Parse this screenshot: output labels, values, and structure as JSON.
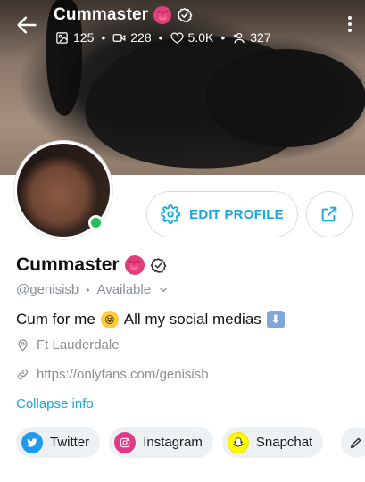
{
  "header": {
    "title": "Cummaster",
    "title_emoji": "👅",
    "stats": {
      "photos": "125",
      "videos": "228",
      "likes": "5.0K",
      "fans": "327"
    }
  },
  "actions": {
    "edit_profile": "EDIT PROFILE"
  },
  "profile": {
    "name": "Cummaster",
    "name_emoji": "👅",
    "handle": "@genisisb",
    "availability": "Available",
    "bio_text": "Cum for me",
    "bio_emoji_face": "😝",
    "bio_text_2": "All my social medias",
    "bio_emoji_arrow": "⬇",
    "location": "Ft Lauderdale",
    "link": "https://onlyfans.com/genisisb",
    "collapse_label": "Collapse info"
  },
  "socials": [
    {
      "label": "Twitter"
    },
    {
      "label": "Instagram"
    },
    {
      "label": "Snapchat"
    }
  ],
  "colors": {
    "accent": "#1aa6e0",
    "online": "#24c15a",
    "muted_text": "#8a8f95",
    "chip_bg": "#eef1f3"
  },
  "icons": {
    "back": "arrow-left-icon",
    "verified": "verified-badge-icon",
    "photos": "image-icon",
    "videos": "video-icon",
    "likes": "heart-icon",
    "fans": "user-plus-icon",
    "more": "kebab-icon",
    "edit": "gear-icon",
    "share": "share-icon",
    "location": "pin-icon",
    "link": "link-icon",
    "twitter": "twitter-icon",
    "instagram": "instagram-icon",
    "snapchat": "snapchat-icon",
    "edit_socials": "pencil-icon"
  }
}
